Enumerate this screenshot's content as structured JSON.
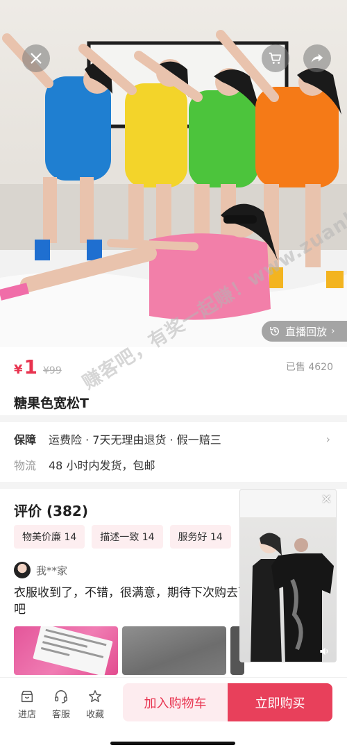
{
  "hero": {
    "replay_label": "直播回放",
    "replay_chevron": "›"
  },
  "price": {
    "currency": "¥",
    "value": "1",
    "original": "¥99",
    "sold": "已售 4620"
  },
  "product": {
    "title": "糖果色宽松T"
  },
  "service": {
    "guarantee_label": "保障",
    "guarantee_text": "运费险 · 7天无理由退货 · 假一赔三",
    "shipping_label": "物流",
    "shipping_text": "48 小时内发货，包邮"
  },
  "reviews": {
    "title": "评价 (382)",
    "tags": [
      "物美价廉 14",
      "描述一致 14",
      "服务好 14"
    ],
    "first": {
      "user": "我**家",
      "text": "衣服收到了，不错，很满意，期待下次购去下单吧"
    }
  },
  "watermark": "赚客吧，有奖一起赚！www.zuanke8.com",
  "bottom": {
    "store_label": "进店",
    "service_label": "客服",
    "favorite_label": "收藏",
    "add_cart_label": "加入购物车",
    "buy_now_label": "立即购买"
  },
  "colors": {
    "accent": "#e8334f",
    "buy_button": "#e8405b",
    "cart_button_bg": "#fdecef",
    "tag_bg": "#fdeef0"
  },
  "icons": [
    "close-icon",
    "cart-icon",
    "share-icon",
    "replay-icon",
    "chevron-right-icon",
    "store-icon",
    "headset-icon",
    "star-icon",
    "mute-icon"
  ]
}
